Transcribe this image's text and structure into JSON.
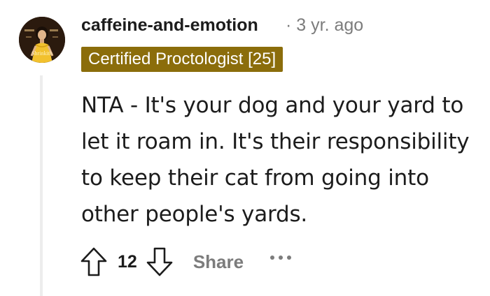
{
  "comment": {
    "avatar": {
      "icon": "user-avatar",
      "caption": "Shrinkith"
    },
    "username": "caffeine-and-emotion",
    "separator": "·",
    "age": "3 yr. ago",
    "flair": "Certified Proctologist [25]",
    "body": "NTA - It's your dog and your yard to let it roam in. It's their responsibility to keep their cat from going into other people's yards.",
    "actions": {
      "upvote_icon": "arrow-up-icon",
      "score": "12",
      "downvote_icon": "arrow-down-icon",
      "share_label": "Share",
      "more_icon": "more-horizontal-icon"
    }
  },
  "colors": {
    "flair_bg": "#8b6d0b",
    "flair_text": "#ffffff",
    "muted": "#7c7c7c",
    "thread_line": "#ededed"
  }
}
